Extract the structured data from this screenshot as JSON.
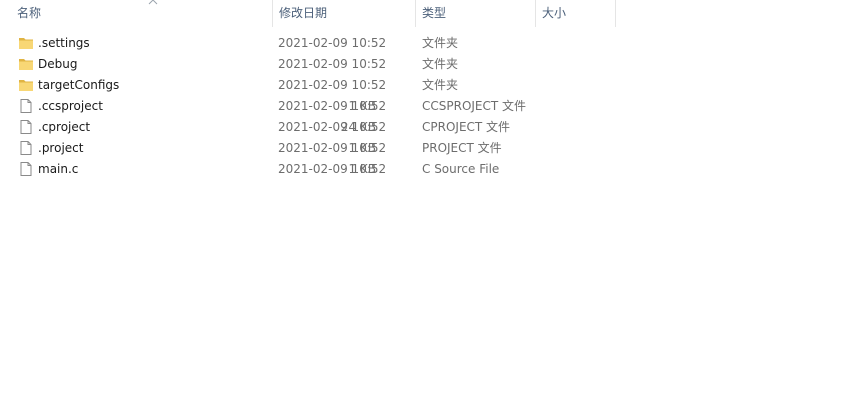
{
  "header": {
    "name_label": "名称",
    "date_label": "修改日期",
    "type_label": "类型",
    "size_label": "大小"
  },
  "files": [
    {
      "name": ".settings",
      "date": "2021-02-09 10:52",
      "type": "文件夹",
      "size": "",
      "icon": "folder-icon"
    },
    {
      "name": "Debug",
      "date": "2021-02-09 10:52",
      "type": "文件夹",
      "size": "",
      "icon": "folder-icon"
    },
    {
      "name": "targetConfigs",
      "date": "2021-02-09 10:52",
      "type": "文件夹",
      "size": "",
      "icon": "folder-icon"
    },
    {
      "name": ".ccsproject",
      "date": "2021-02-09 10:52",
      "type": "CCSPROJECT 文件",
      "size": "1 KB",
      "icon": "file-icon"
    },
    {
      "name": ".cproject",
      "date": "2021-02-09 10:52",
      "type": "CPROJECT 文件",
      "size": "24 KB",
      "icon": "file-icon"
    },
    {
      "name": ".project",
      "date": "2021-02-09 10:52",
      "type": "PROJECT 文件",
      "size": "1 KB",
      "icon": "file-icon"
    },
    {
      "name": "main.c",
      "date": "2021-02-09 10:52",
      "type": "C Source File",
      "size": "1 KB",
      "icon": "file-icon"
    }
  ],
  "colors": {
    "header_text": "#4c607a",
    "folder": "#f8d775",
    "folder_dark": "#e0b443",
    "secondary_text": "#6d6d6d"
  }
}
